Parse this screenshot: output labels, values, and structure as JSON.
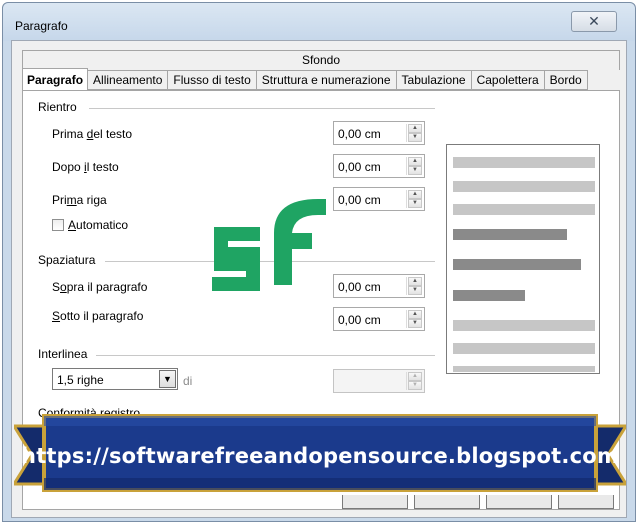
{
  "window": {
    "title": "Paragrafo",
    "close_glyph": "✕"
  },
  "tabs": {
    "back_row": "Sfondo",
    "items": [
      {
        "label": "Paragrafo",
        "active": true
      },
      {
        "label": "Allineamento"
      },
      {
        "label": "Flusso di testo"
      },
      {
        "label": "Struttura e numerazione"
      },
      {
        "label": "Tabulazione"
      },
      {
        "label": "Capolettera"
      },
      {
        "label": "Bordo"
      }
    ]
  },
  "rientro": {
    "heading": "Rientro",
    "prima_del_testo": {
      "label_pre": "Prima ",
      "label_ul": "d",
      "label_post": "el testo",
      "value": "0,00 cm"
    },
    "dopo_il_testo": {
      "label_pre": "Dopo ",
      "label_ul": "i",
      "label_post": "l testo",
      "value": "0,00 cm"
    },
    "prima_riga": {
      "label_pre": "Pri",
      "label_ul": "m",
      "label_post": "a riga",
      "value": "0,00 cm"
    },
    "automatico": {
      "label_ul": "A",
      "label_post": "utomatico",
      "checked": false
    }
  },
  "spaziatura": {
    "heading": "Spaziatura",
    "sopra": {
      "label_pre": "S",
      "label_ul": "o",
      "label_post": "pra il paragrafo",
      "value": "0,00 cm"
    },
    "sotto": {
      "label_ul": "S",
      "label_post": "otto il paragrafo",
      "value": "0,00 cm"
    }
  },
  "interlinea": {
    "heading": "Interlinea",
    "selected": "1,5 righe",
    "di_label": "di",
    "value": ""
  },
  "conformita": {
    "heading": "Conformità registro"
  },
  "watermark": {
    "logo_text": "sf",
    "color": "#1fa463"
  },
  "banner": {
    "text": "https://softwarefreeandopensource.blogspot.com",
    "color_main": "#1b3a8c",
    "color_trim": "#c9a23a"
  }
}
